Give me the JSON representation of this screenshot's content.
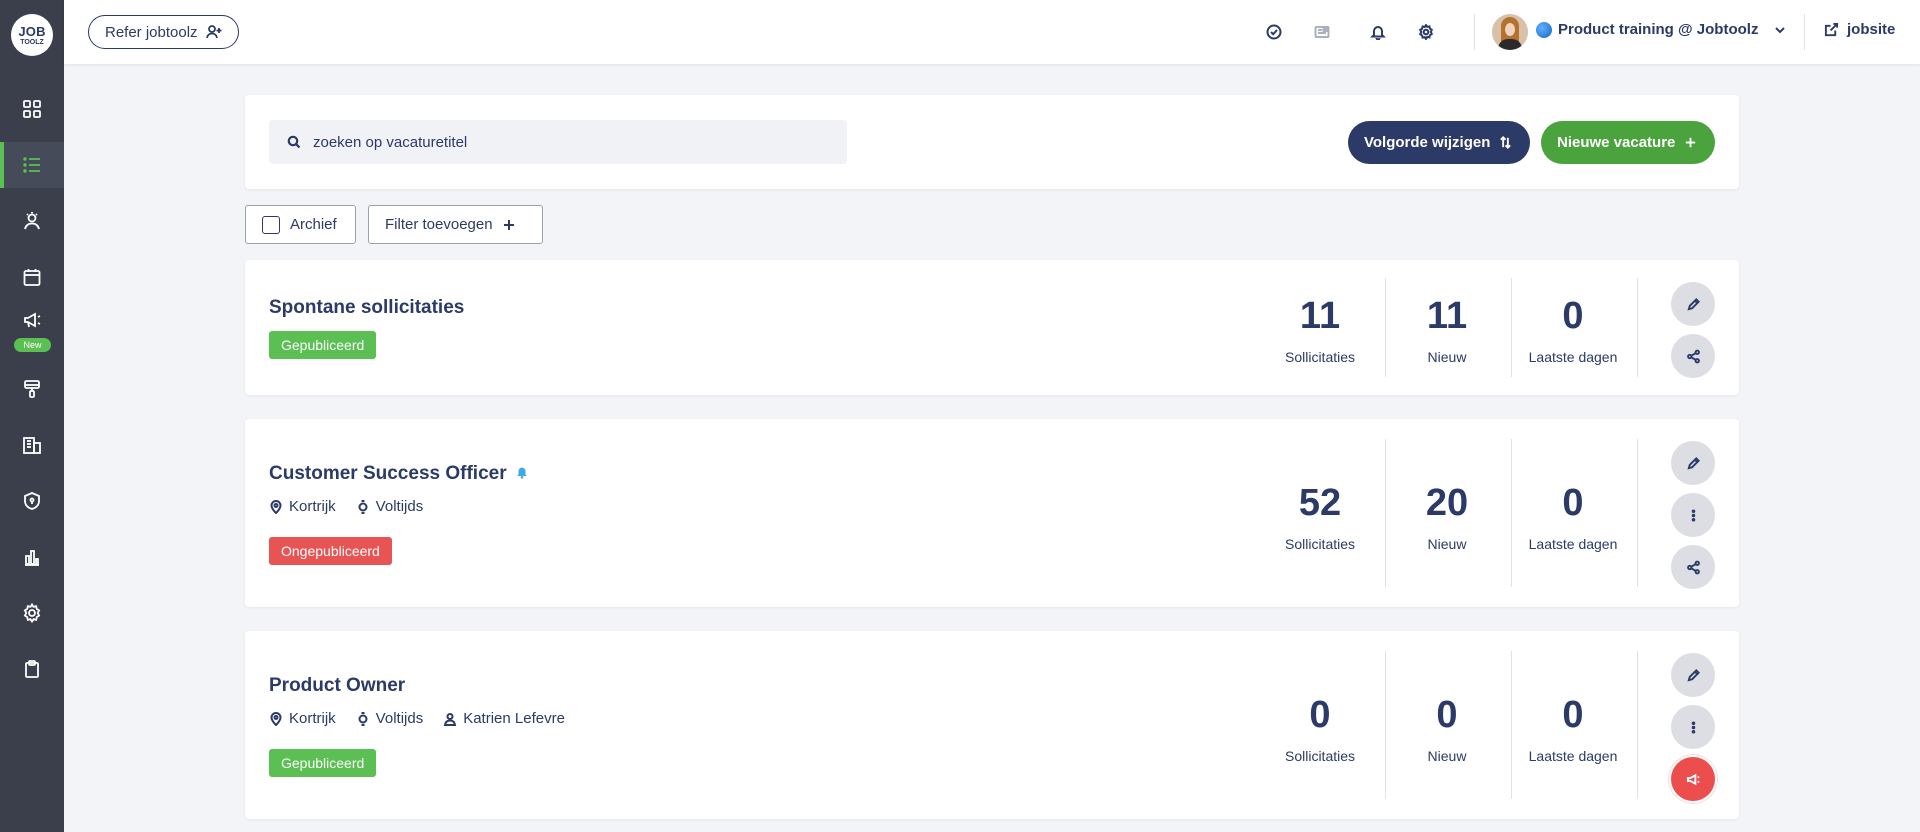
{
  "brand": {
    "logo_line1": "JOB",
    "logo_line2": "TOOLZ"
  },
  "sidebar": {
    "items": [
      {
        "name": "dashboard",
        "icon": "grid-icon"
      },
      {
        "name": "vacatures",
        "icon": "list-icon",
        "active": true
      },
      {
        "name": "kandidaten",
        "icon": "person-icon"
      },
      {
        "name": "agenda",
        "icon": "calendar-icon"
      },
      {
        "name": "campagnes",
        "icon": "megaphone-icon",
        "badge": "New"
      },
      {
        "name": "branding",
        "icon": "paint-roller-icon"
      },
      {
        "name": "bedrijven",
        "icon": "building-icon"
      },
      {
        "name": "privacy",
        "icon": "shield-icon"
      },
      {
        "name": "rapporten",
        "icon": "bar-chart-icon"
      },
      {
        "name": "instellingen",
        "icon": "gear-icon"
      },
      {
        "name": "jobs",
        "icon": "clipboard-icon"
      }
    ]
  },
  "topbar": {
    "refer_label": "Refer jobtoolz",
    "org_label": "Product training @ Jobtoolz",
    "jobsite_label": "jobsite"
  },
  "search": {
    "placeholder": "zoeken op vacaturetitel"
  },
  "actions": {
    "reorder_label": "Volgorde wijzigen",
    "new_label": "Nieuwe vacature"
  },
  "filters": {
    "archive_label": "Archief",
    "add_filter_label": "Filter toevoegen"
  },
  "stat_labels": {
    "applications": "Sollicitaties",
    "new": "Nieuw",
    "recent": "Laatste dagen"
  },
  "jobs": [
    {
      "title": "Spontane sollicitaties",
      "status": "Gepubliceerd",
      "applications": "11",
      "new": "11",
      "recent": "0"
    },
    {
      "title": "Customer Success Officer",
      "location": "Kortrijk",
      "regime": "Voltijds",
      "status": "Ongepubliceerd",
      "applications": "52",
      "new": "20",
      "recent": "0"
    },
    {
      "title": "Product Owner",
      "location": "Kortrijk",
      "regime": "Voltijds",
      "owner": "Katrien Lefevre",
      "status": "Gepubliceerd",
      "applications": "0",
      "new": "0",
      "recent": "0"
    }
  ],
  "colors": {
    "navy": "#2b3a67",
    "green": "#4ba33d",
    "published": "#5bbf53",
    "unpublished": "#e85454",
    "sidebar": "#3a3f4b",
    "bell": "#3fa9e0"
  }
}
